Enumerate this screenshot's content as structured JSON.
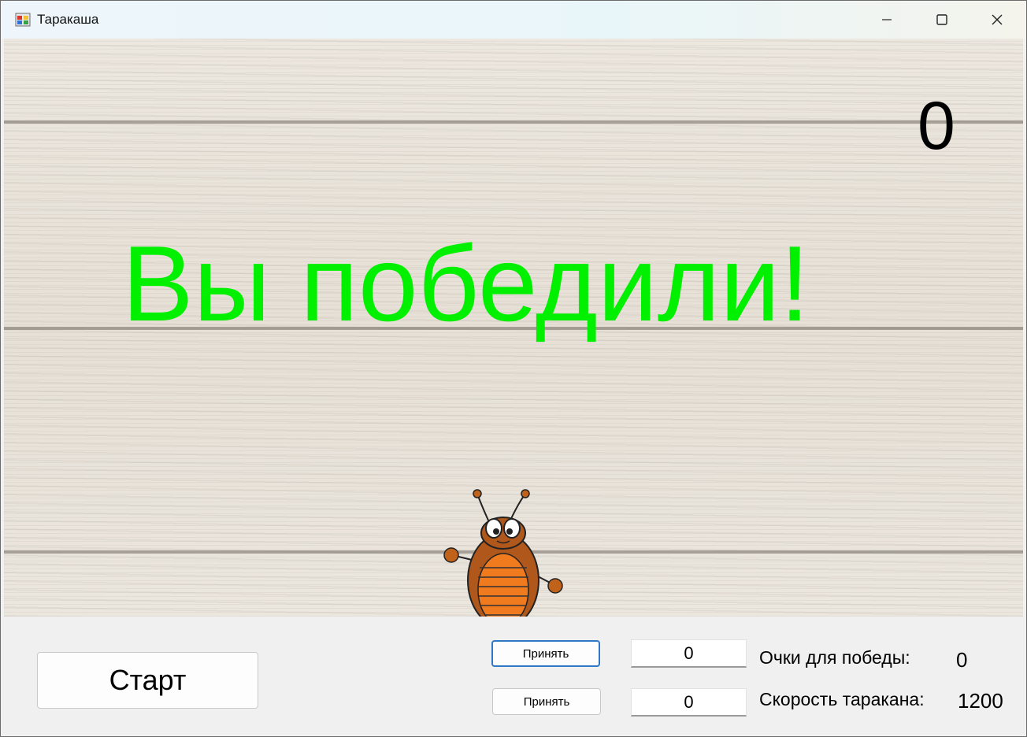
{
  "window": {
    "title": "Таракаша"
  },
  "game": {
    "score": "0",
    "message": "Вы победили!",
    "message_color": "#00f000",
    "character": "cockroach"
  },
  "controls": {
    "start_label": "Старт",
    "accept_win_label": "Принять",
    "accept_speed_label": "Принять",
    "win_points_input": "0",
    "speed_input": "0",
    "win_points_label": "Очки для победы:",
    "win_points_value": "0",
    "speed_label": "Скорость таракана:",
    "speed_value": "1200"
  }
}
